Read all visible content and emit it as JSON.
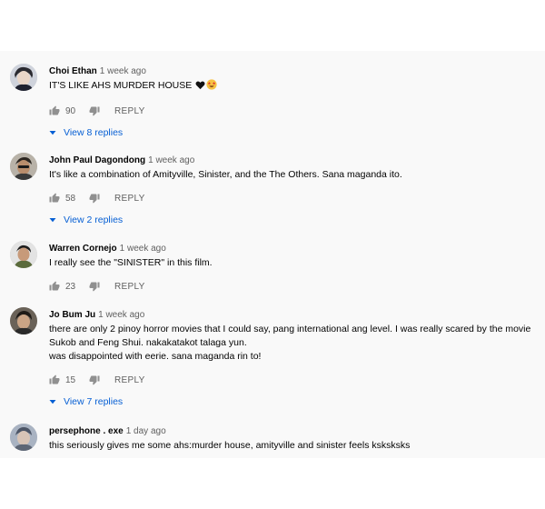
{
  "comments": [
    {
      "author": "Choi Ethan",
      "time": "1 week ago",
      "text": "IT'S LIKE AHS MURDER HOUSE",
      "emoji_names": [
        "black-heart-icon",
        "star-struck-emoji-icon"
      ],
      "likes": "90",
      "reply_label": "REPLY",
      "view_replies": "View 8 replies"
    },
    {
      "author": "John Paul Dagondong",
      "time": "1 week ago",
      "text": "It's like a combination of Amityville, Sinister, and the The Others. Sana maganda ito.",
      "likes": "58",
      "reply_label": "REPLY",
      "view_replies": "View 2 replies"
    },
    {
      "author": "Warren Cornejo",
      "time": "1 week ago",
      "text": "I really see the \"SINISTER\" in this film.",
      "likes": "23",
      "reply_label": "REPLY"
    },
    {
      "author": "Jo Bum Ju",
      "time": "1 week ago",
      "text_lines": [
        "there are only 2 pinoy horror movies that I could say, pang international ang level. I was really scared by the movie",
        "Sukob and Feng Shui. nakakatakot talaga yun.",
        "was disappointed with eerie. sana maganda rin to!"
      ],
      "likes": "15",
      "reply_label": "REPLY",
      "view_replies": "View 7 replies"
    },
    {
      "author": "persephone . exe",
      "time": "1 day ago",
      "text": "this seriously gives me some ahs:murder house, amityville and sinister feels ksksksks"
    }
  ],
  "colors": {
    "panel_bg": "#f9f9f9",
    "author": "#030303",
    "secondary": "#606060",
    "link": "#065fd4"
  },
  "icons": {
    "like": "thumb-up-icon",
    "dislike": "thumb-down-icon",
    "expand": "caret-down-icon"
  }
}
